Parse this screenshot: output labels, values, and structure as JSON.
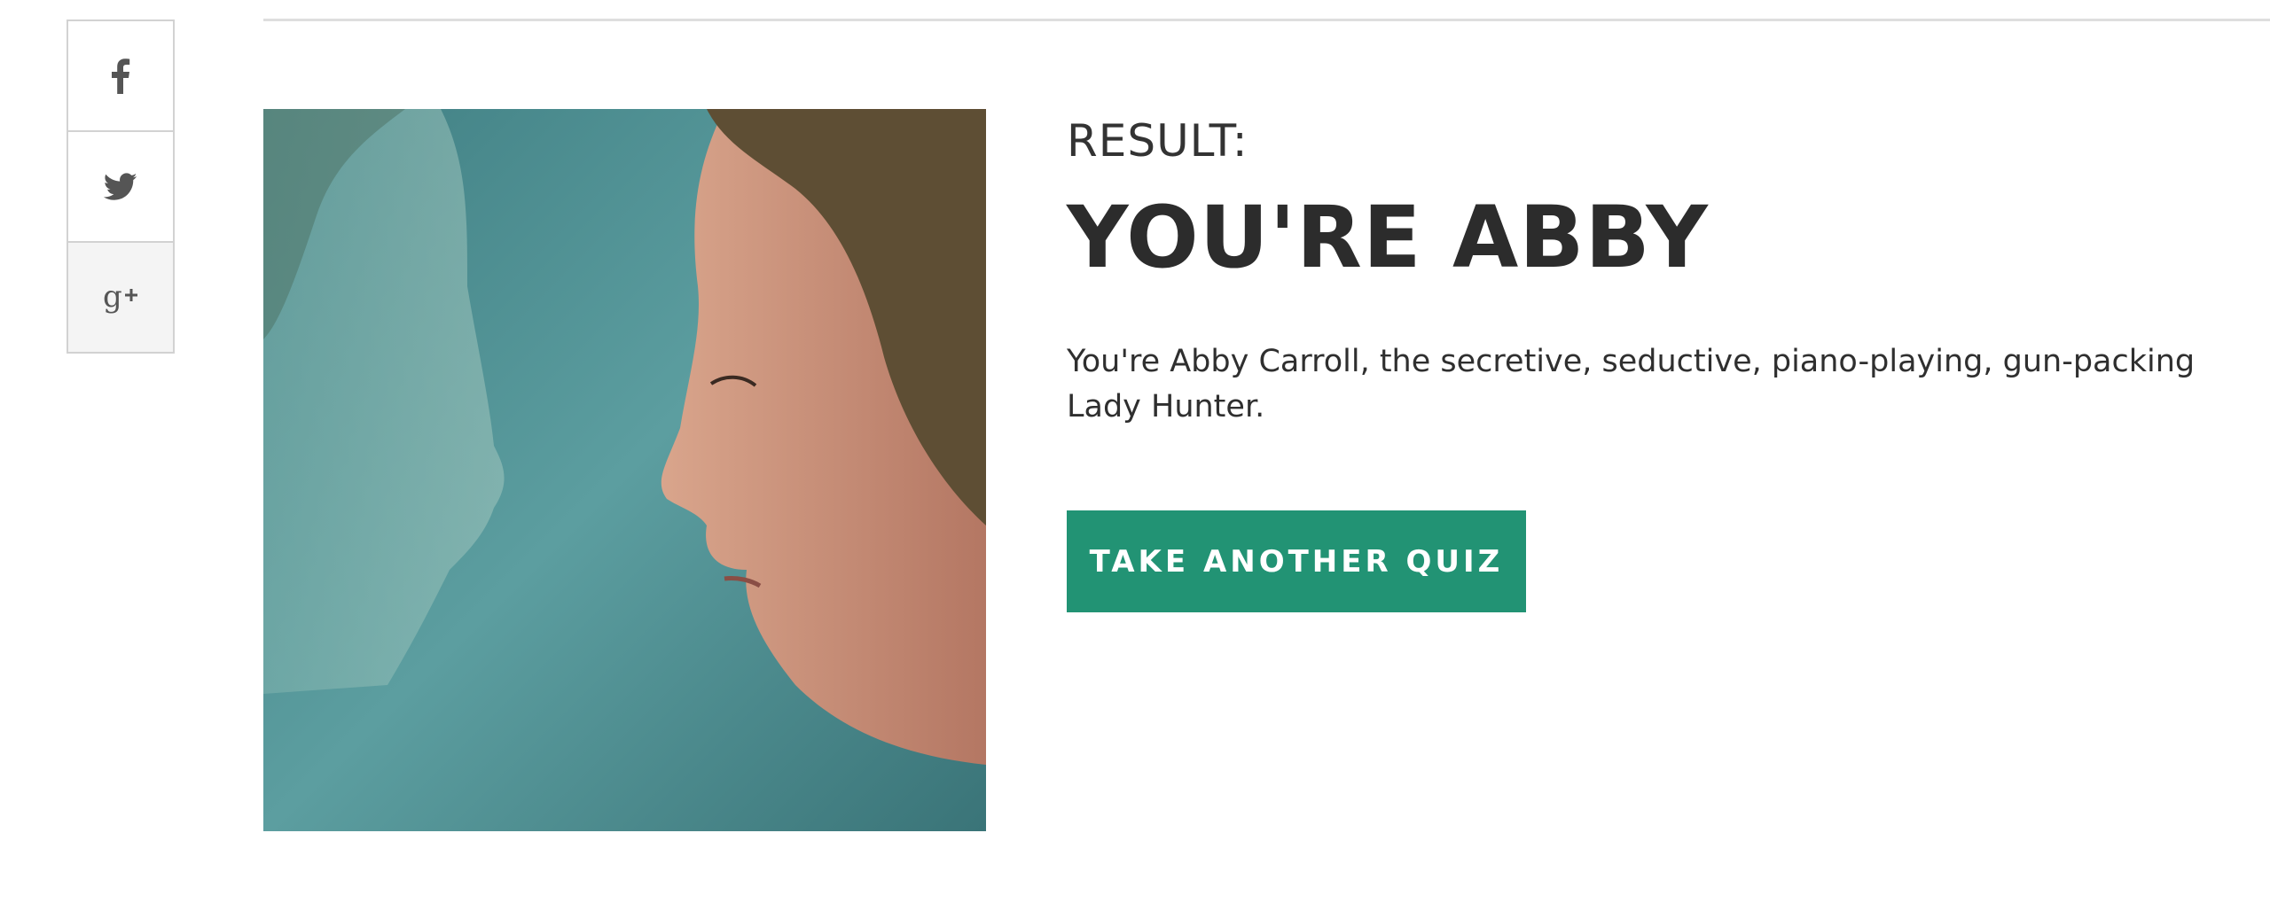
{
  "share": {
    "buttons": [
      {
        "icon": "facebook-icon",
        "glyph": "f"
      },
      {
        "icon": "twitter-icon"
      },
      {
        "icon": "google-plus-icon",
        "glyph": "g+"
      }
    ]
  },
  "result": {
    "label": "RESULT:",
    "title": "YOU'RE ABBY",
    "description": "You're Abby Carroll, the secretive, seductive, piano-playing, gun-packing Lady Hunter.",
    "cta_label": "TAKE ANOTHER QUIZ"
  },
  "colors": {
    "accent": "#229374",
    "image_tint": "#4f8e92"
  }
}
